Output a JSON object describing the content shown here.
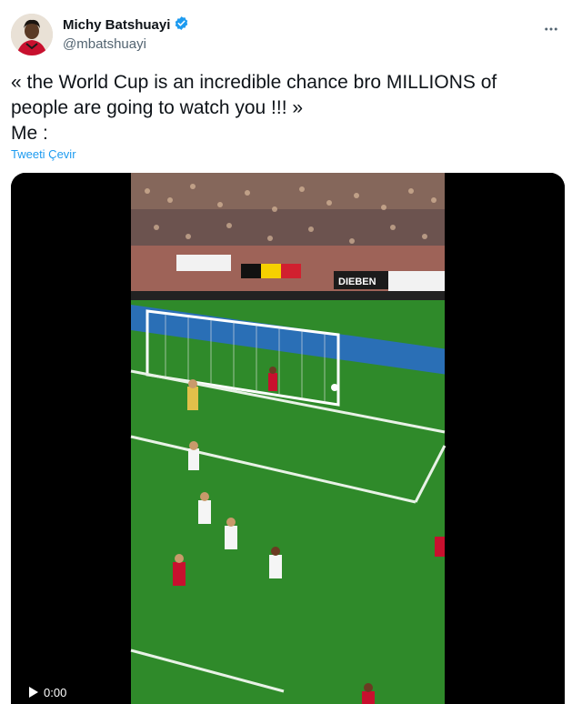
{
  "author": {
    "display_name": "Michy Batshuayi",
    "handle": "@mbatshuayi",
    "verified": true,
    "avatar_icon": "profile-photo"
  },
  "menu": {
    "more_icon": "more-horizontal-icon"
  },
  "tweet": {
    "text": "« the World Cup is an incredible chance bro MILLIONS of\npeople are going to watch you !!! »\nMe :",
    "translate_label": "Tweeti Çevir"
  },
  "media": {
    "type": "video",
    "stadium_board": "DIEBEN",
    "time_label": "0:00"
  },
  "colors": {
    "link": "#1d9bf0",
    "verified": "#1d9bf0",
    "secondary_text": "#536471",
    "pitch": "#2f8a2a"
  }
}
